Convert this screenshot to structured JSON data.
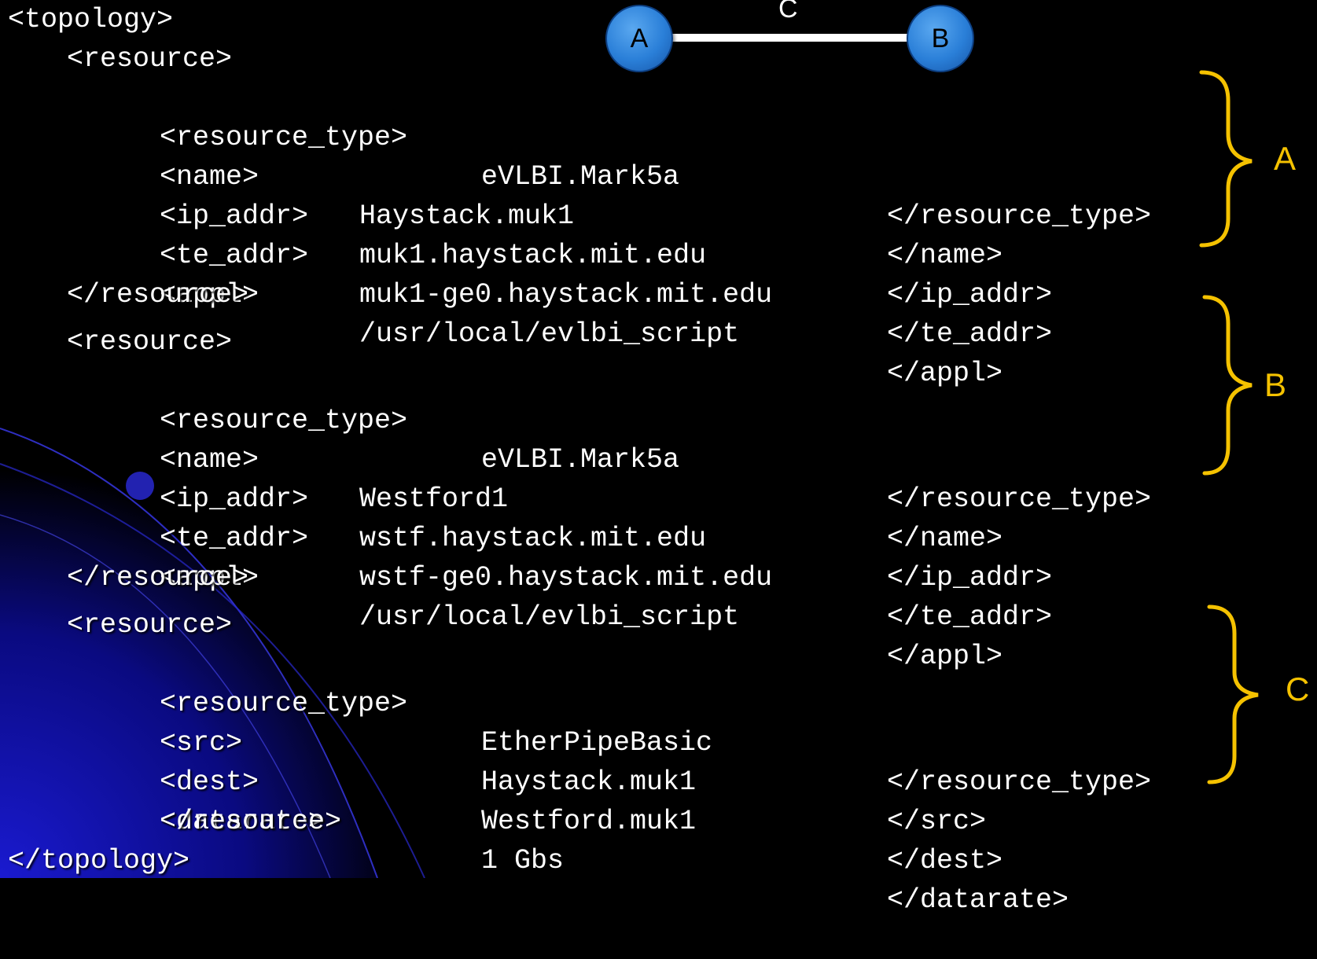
{
  "diagram": {
    "node_a": "A",
    "node_b": "B",
    "link_label": "C"
  },
  "braces": {
    "a_label": "A",
    "b_label": "B",
    "c_label": "C",
    "color": "#f5c200"
  },
  "code": {
    "open_topology": "<topology>",
    "close_topology": "</topology>",
    "resources": [
      {
        "open": "<resource>",
        "close": "</resource>",
        "fields": [
          {
            "tag": "<resource_type>",
            "value": "eVLBI.Mark5a",
            "close": "</resource_type>"
          },
          {
            "tag": "<name>",
            "value": "Haystack.muk1",
            "close": "</name>"
          },
          {
            "tag": "<ip_addr>",
            "value": "muk1.haystack.mit.edu",
            "close": "</ip_addr>"
          },
          {
            "tag": "<te_addr>",
            "value": "muk1-ge0.haystack.mit.edu",
            "close": "</te_addr>"
          },
          {
            "tag": "<appl>",
            "value": "/usr/local/evlbi_script",
            "close": "</appl>"
          }
        ]
      },
      {
        "open": "<resource>",
        "close": "</resource>",
        "fields": [
          {
            "tag": "<resource_type>",
            "value": "eVLBI.Mark5a",
            "close": "</resource_type>"
          },
          {
            "tag": "<name>",
            "value": "Westford1",
            "close": "</name>"
          },
          {
            "tag": "<ip_addr>",
            "value": "wstf.haystack.mit.edu",
            "close": "</ip_addr>"
          },
          {
            "tag": "<te_addr>",
            "value": "wstf-ge0.haystack.mit.edu",
            "close": "</te_addr>"
          },
          {
            "tag": "<appl>",
            "value": "/usr/local/evlbi_script",
            "close": "</appl>"
          }
        ]
      },
      {
        "open": "<resource>",
        "close": "</resource>",
        "fields": [
          {
            "tag": "<resource_type>",
            "value": "EtherPipeBasic",
            "close": "</resource_type>"
          },
          {
            "tag": "<src>",
            "value": "Haystack.muk1",
            "close": "</src>"
          },
          {
            "tag": "<dest>",
            "value": "Westford.muk1",
            "close": "</dest>"
          },
          {
            "tag": "<datarate>",
            "value": "1 Gbs",
            "close": "</datarate>"
          }
        ]
      }
    ]
  }
}
